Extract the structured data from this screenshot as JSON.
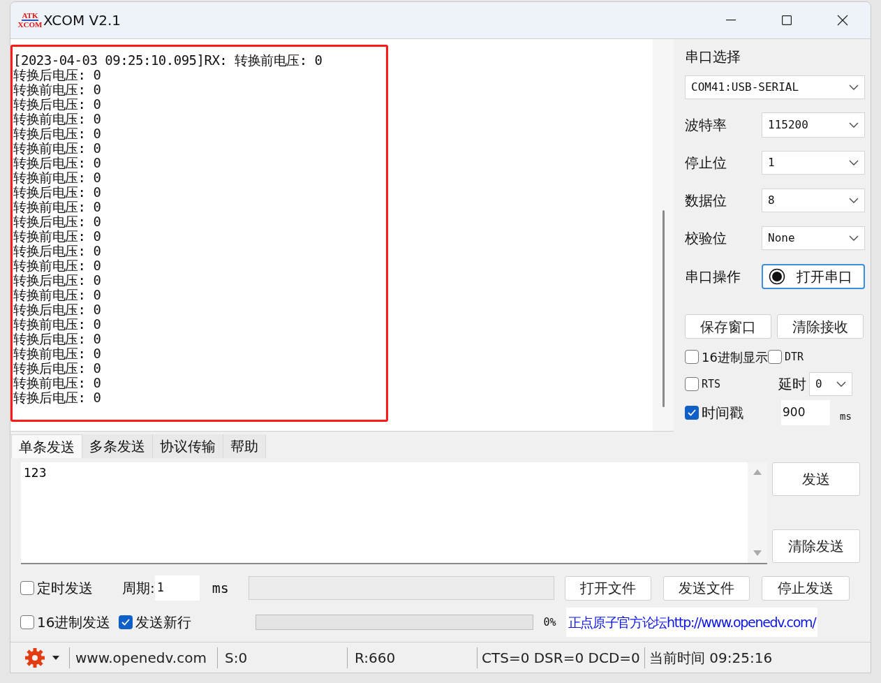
{
  "window": {
    "title": "XCOM V2.1",
    "logo": {
      "top": "ATK",
      "bottom": "XCOM"
    }
  },
  "receive": {
    "lines": [
      "[2023-04-03 09:25:10.095]RX: 转换前电压: 0",
      "转换后电压: 0",
      "转换前电压: 0",
      "转换后电压: 0",
      "转换前电压: 0",
      "转换后电压: 0",
      "转换前电压: 0",
      "转换后电压: 0",
      "转换前电压: 0",
      "转换后电压: 0",
      "转换前电压: 0",
      "转换后电压: 0",
      "转换前电压: 0",
      "转换后电压: 0",
      "转换前电压: 0",
      "转换后电压: 0",
      "转换前电压: 0",
      "转换后电压: 0",
      "转换前电压: 0",
      "转换后电压: 0",
      "转换前电压: 0",
      "转换后电压: 0",
      "转换前电压: 0",
      "转换后电压: 0"
    ]
  },
  "serial": {
    "port_label": "串口选择",
    "port": "COM41:USB-SERIAL",
    "settings": [
      {
        "label": "波特率",
        "value": "115200"
      },
      {
        "label": "停止位",
        "value": "1"
      },
      {
        "label": "数据位",
        "value": "8"
      },
      {
        "label": "校验位",
        "value": "None"
      }
    ],
    "operation_label": "串口操作",
    "open_button": "打开串口",
    "save_button": "保存窗口",
    "clear_button": "清除接收",
    "hex_display": {
      "label": "16进制显示",
      "checked": false
    },
    "dtr": {
      "label": "DTR",
      "checked": false
    },
    "rts": {
      "label": "RTS",
      "checked": false
    },
    "delay_label": "延时",
    "delay": "0",
    "timestamp": {
      "label": "时间戳",
      "checked": true
    },
    "timestamp_value": "900",
    "timestamp_unit": "ms"
  },
  "send": {
    "tabs": [
      {
        "label": "单条发送",
        "selected": true
      },
      {
        "label": "多条发送",
        "selected": false
      },
      {
        "label": "协议传输",
        "selected": false
      },
      {
        "label": "帮助",
        "selected": false
      }
    ],
    "text": "123",
    "send_button": "发送",
    "clear_button": "清除发送",
    "timed": {
      "label": "定时发送",
      "checked": false
    },
    "period_label": "周期:",
    "period": "1",
    "period_unit": "ms",
    "open_file": "打开文件",
    "send_file": "发送文件",
    "stop_send": "停止发送",
    "hex_send": {
      "label": "16进制发送",
      "checked": false
    },
    "newline": {
      "label": "发送新行",
      "checked": true
    },
    "progress": {
      "level": 0,
      "reading": "0%"
    },
    "forum_link": "正点原子官方论坛http://www.openedv.com/"
  },
  "status_bar": {
    "url": "www.openedv.com",
    "sent": "S:0",
    "received": "R:660",
    "lines": "CTS=0 DSR=0 DCD=0",
    "time": "当前时间 09:25:16"
  }
}
